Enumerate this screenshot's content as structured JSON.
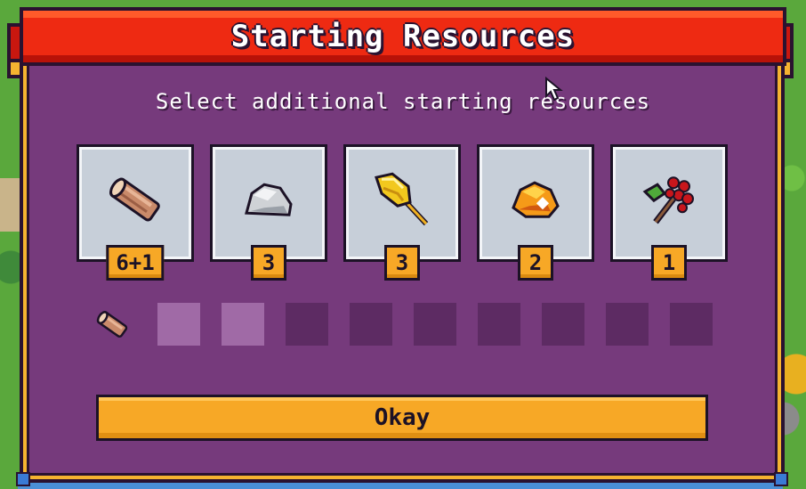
{
  "dialog": {
    "title": "Starting Resources",
    "subtitle": "Select additional starting resources",
    "okay_label": "Okay"
  },
  "resources": [
    {
      "name": "log",
      "icon": "log-icon",
      "count": "6+1"
    },
    {
      "name": "stone",
      "icon": "stone-icon",
      "count": "3"
    },
    {
      "name": "wheat",
      "icon": "wheat-icon",
      "count": "3"
    },
    {
      "name": "gold ore",
      "icon": "gold-ore-icon",
      "count": "2"
    },
    {
      "name": "berries",
      "icon": "berry-branch-icon",
      "count": "1"
    }
  ],
  "selection": {
    "icon": "log-icon",
    "slots_total": 9,
    "slots_filled": 2
  },
  "colors": {
    "panel": "#763a7c",
    "ribbon": "#ee2a12",
    "accent": "#f7a826",
    "card": "#c7cfd9"
  }
}
